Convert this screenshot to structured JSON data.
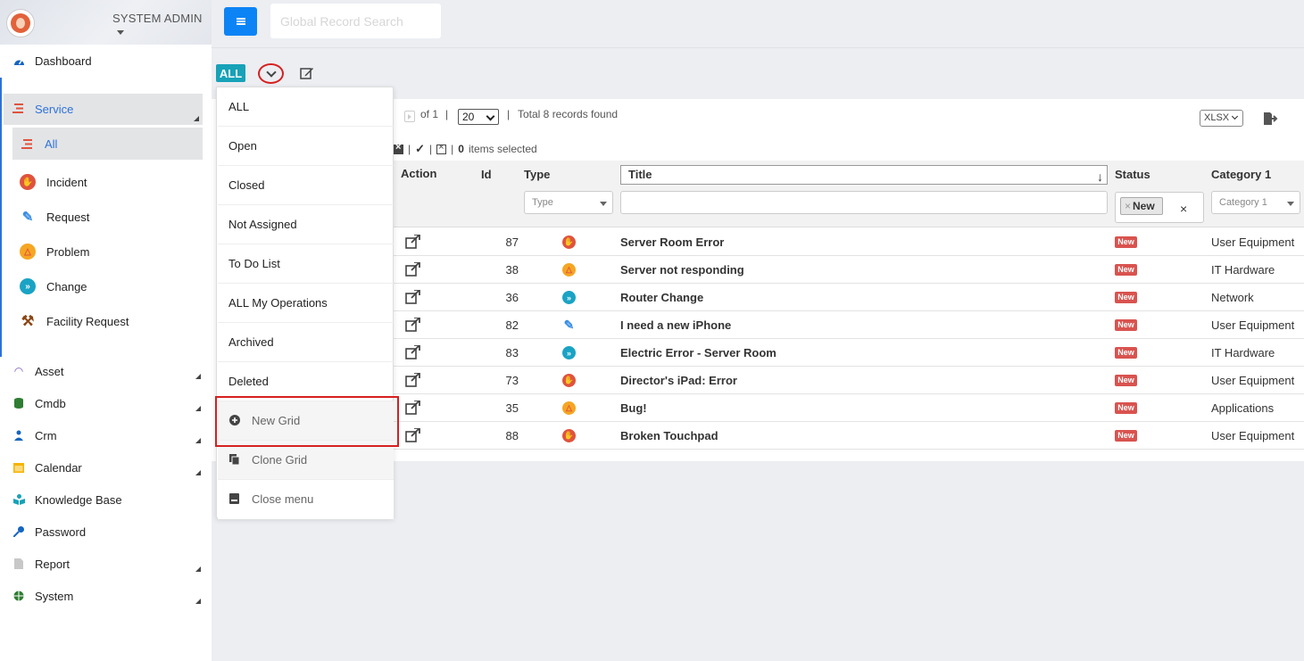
{
  "sidebar": {
    "user": "SYSTEM ADMIN",
    "dashboard": "Dashboard",
    "service": "Service",
    "service_all": "All",
    "service_items": [
      {
        "label": "Incident",
        "icon": "incident-icon",
        "color": "#e0533d"
      },
      {
        "label": "Request",
        "icon": "request-icon",
        "color": "#3a8ee6"
      },
      {
        "label": "Problem",
        "icon": "problem-icon",
        "color": "#f5a623"
      },
      {
        "label": "Change",
        "icon": "change-icon",
        "color": "#1aa3c4"
      },
      {
        "label": "Facility Request",
        "icon": "hammer-icon",
        "color": "#8b4513"
      }
    ],
    "modules": [
      {
        "label": "Asset",
        "icon": "wifi-icon",
        "color": "#7e57c2"
      },
      {
        "label": "Cmdb",
        "icon": "database-icon",
        "color": "#2e7d32"
      },
      {
        "label": "Crm",
        "icon": "users-icon",
        "color": "#1565c0"
      },
      {
        "label": "Calendar",
        "icon": "calendar-icon",
        "color": "#f5b400"
      },
      {
        "label": "Knowledge Base",
        "icon": "book-icon",
        "color": "#17a2b8"
      },
      {
        "label": "Password",
        "icon": "key-icon",
        "color": "#1565c0"
      },
      {
        "label": "Report",
        "icon": "file-icon",
        "color": "#bbbbbb"
      },
      {
        "label": "System",
        "icon": "globe-icon",
        "color": "#2e7d32"
      }
    ]
  },
  "topbar": {
    "search_placeholder": "Global Record Search"
  },
  "toolbar": {
    "all_badge": "ALL"
  },
  "pager": {
    "of": "of 1",
    "sep1": "|",
    "page_size": "20",
    "sep2": "|",
    "total": "Total 8 records found",
    "export_format": "XLSX",
    "items_selected_count": "0",
    "items_selected_text": "items selected"
  },
  "columns": {
    "action": "Action",
    "id": "Id",
    "type": "Type",
    "title": "Title",
    "status": "Status",
    "category": "Category 1",
    "type_filter_placeholder": "Type",
    "category_filter_placeholder": "Category 1",
    "status_filter_chip": "New"
  },
  "rows": [
    {
      "id": "87",
      "type_icon": "incident-icon",
      "type_color": "#e0533d",
      "title": "Server Room Error",
      "status": "New",
      "category": "User Equipment"
    },
    {
      "id": "38",
      "type_icon": "problem-icon",
      "type_color": "#f5a623",
      "title": "Server not responding",
      "status": "New",
      "category": "IT Hardware"
    },
    {
      "id": "36",
      "type_icon": "change-icon",
      "type_color": "#1aa3c4",
      "title": "Router Change",
      "status": "New",
      "category": "Network"
    },
    {
      "id": "82",
      "type_icon": "request-icon",
      "type_color": "#3a8ee6",
      "title": "I need a new iPhone",
      "status": "New",
      "category": "User Equipment"
    },
    {
      "id": "83",
      "type_icon": "change-icon",
      "type_color": "#1aa3c4",
      "title": "Electric Error - Server Room",
      "status": "New",
      "category": "IT Hardware"
    },
    {
      "id": "73",
      "type_icon": "incident-icon",
      "type_color": "#e0533d",
      "title": "Director's iPad: Error",
      "status": "New",
      "category": "User Equipment"
    },
    {
      "id": "35",
      "type_icon": "problem-icon",
      "type_color": "#f5a623",
      "title": "Bug!",
      "status": "New",
      "category": "Applications"
    },
    {
      "id": "88",
      "type_icon": "incident-icon",
      "type_color": "#e0533d",
      "title": "Broken Touchpad",
      "status": "New",
      "category": "User Equipment"
    }
  ],
  "dropdown": {
    "views": [
      "ALL",
      "Open",
      "Closed",
      "Not Assigned",
      "To Do List",
      "ALL My Operations",
      "Archived",
      "Deleted"
    ],
    "actions": [
      {
        "label": "New Grid",
        "icon": "plus-circle-icon"
      },
      {
        "label": "Clone Grid",
        "icon": "copy-icon"
      },
      {
        "label": "Close menu",
        "icon": "close-menu-icon"
      }
    ]
  },
  "colors": {
    "accent": "#2d72d9",
    "primary_button": "#0d84f5",
    "badge_teal": "#17a2b8",
    "status_new": "#d9534f",
    "highlight": "#d62020"
  }
}
